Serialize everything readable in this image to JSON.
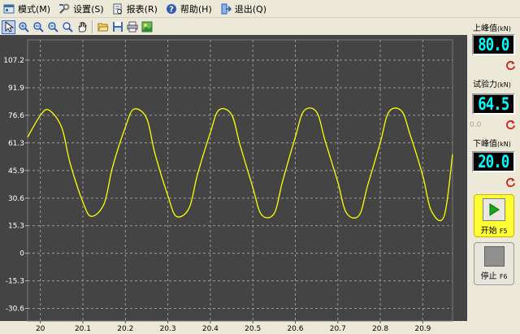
{
  "menu": [
    {
      "label": "模式(M)",
      "icon": "mode-icon"
    },
    {
      "label": "设置(S)",
      "icon": "settings-wrench-icon"
    },
    {
      "label": "报表(R)",
      "icon": "report-icon"
    },
    {
      "label": "帮助(H)",
      "icon": "help-icon"
    },
    {
      "label": "退出(Q)",
      "icon": "exit-icon"
    }
  ],
  "toolbar": [
    {
      "name": "pointer-tool",
      "icon": "cursor-arrow-icon",
      "active": true
    },
    {
      "name": "zoom-in-tool",
      "icon": "zoom-in-icon"
    },
    {
      "name": "zoom-x-tool",
      "icon": "zoom-x-icon"
    },
    {
      "name": "zoom-out-tool",
      "icon": "zoom-out-icon"
    },
    {
      "name": "zoom-fit-tool",
      "icon": "zoom-fit-icon"
    },
    {
      "name": "pan-tool",
      "icon": "hand-pan-icon"
    },
    {
      "name": "open-tool",
      "icon": "folder-open-icon"
    },
    {
      "name": "save-tool",
      "icon": "save-disk-icon"
    },
    {
      "name": "print-tool",
      "icon": "printer-icon"
    },
    {
      "name": "export-tool",
      "icon": "export-image-icon"
    }
  ],
  "panel": {
    "upper_peak": {
      "label": "上峰值",
      "unit": "(kN)",
      "value": "80.0"
    },
    "test_force": {
      "label": "试验力",
      "unit": "(kN)",
      "value": "64.5",
      "secondary": "0.0"
    },
    "lower_peak": {
      "label": "下峰值",
      "unit": "(kN)",
      "value": "20.0"
    },
    "start_button": {
      "label": "开始",
      "key": "F5"
    },
    "stop_button": {
      "label": "停止",
      "key": "F6"
    }
  },
  "colors": {
    "plot_background": "#444444",
    "grid": "#9a9a9a",
    "series": "#ffff00",
    "lcd_text": "#00ffff"
  },
  "chart_data": {
    "type": "line",
    "title": "",
    "xlabel": "",
    "ylabel": "",
    "x_ticks": [
      "20",
      "20.1",
      "20.2",
      "20.3",
      "20.4",
      "20.5",
      "20.6",
      "20.7",
      "20.8",
      "20.9"
    ],
    "y_ticks": [
      "107.2",
      "91.9",
      "76.6",
      "61.3",
      "45.9",
      "30.6",
      "15.3",
      "0",
      "-15.3",
      "-30.6"
    ],
    "xlim": [
      19.97,
      20.97
    ],
    "ylim": [
      -37.6,
      118.5
    ],
    "grid": true,
    "series": [
      {
        "x": [
          19.97,
          20.0,
          20.02,
          20.05,
          20.07,
          20.1,
          20.12,
          20.15,
          20.17,
          20.2,
          20.22,
          20.25,
          20.27,
          20.3,
          20.32,
          20.35,
          20.37,
          20.4,
          20.42,
          20.45,
          20.47,
          20.5,
          20.52,
          20.55,
          20.57,
          20.6,
          20.62,
          20.65,
          20.67,
          20.7,
          20.72,
          20.75,
          20.77,
          20.8,
          20.82,
          20.85,
          20.87,
          20.9,
          20.92,
          20.95,
          20.97
        ],
        "y": [
          64.5,
          76.5,
          79.5,
          70.0,
          50.0,
          28.5,
          20.5,
          27.5,
          48.0,
          70.0,
          80.0,
          75.0,
          55.0,
          32.0,
          20.5,
          25.0,
          44.0,
          67.0,
          79.5,
          77.0,
          60.0,
          36.5,
          21.5,
          22.0,
          40.0,
          64.5,
          79.0,
          78.5,
          62.5,
          39.5,
          22.5,
          21.0,
          37.5,
          61.5,
          78.5,
          79.0,
          66.0,
          43.0,
          23.5,
          20.5,
          55.0
        ]
      }
    ]
  }
}
